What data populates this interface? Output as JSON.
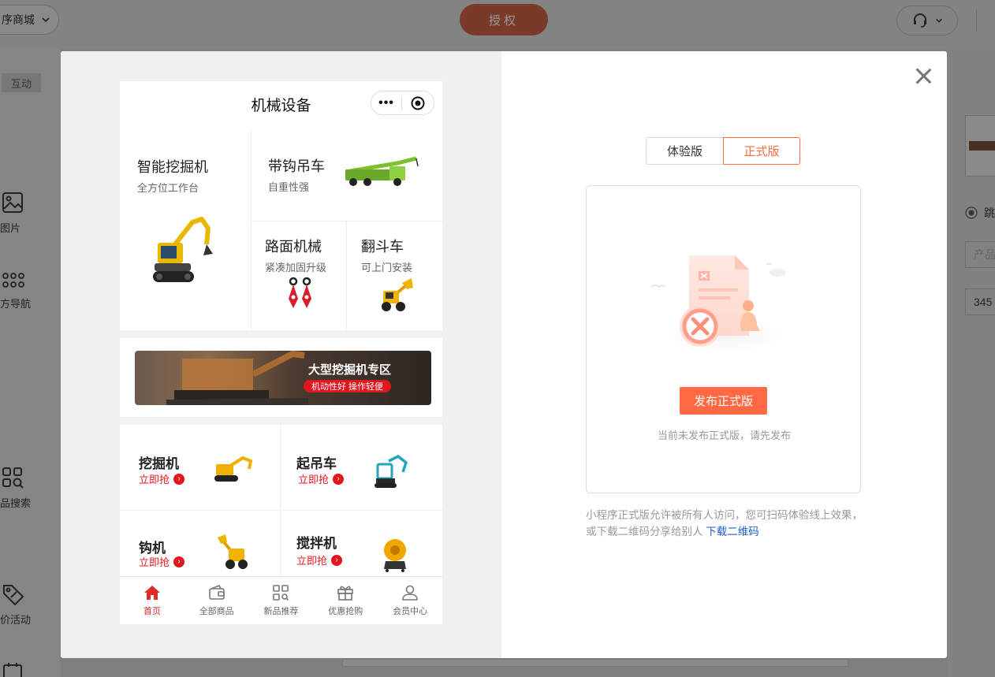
{
  "background": {
    "store_label": "序商城",
    "auth_label": "授权",
    "side_tag": "互动",
    "side_items": [
      {
        "label": "图片",
        "icon": "image-icon"
      },
      {
        "label": "方导航",
        "icon": "grid-dots-icon"
      },
      {
        "label": "品搜索",
        "icon": "search-grid-icon"
      },
      {
        "label": "价活动",
        "icon": "tag-icon"
      }
    ],
    "right_radio": "跳",
    "right_field1": "产品",
    "right_field2": "345"
  },
  "preview": {
    "title": "机械设备",
    "categories": [
      {
        "title": "智能挖掘机",
        "subtitle": "全方位工作台"
      },
      {
        "title": "带钩吊车",
        "subtitle": "自重性强"
      },
      {
        "title": "路面机械",
        "subtitle": "紧凑加固升级"
      },
      {
        "title": "翻斗车",
        "subtitle": "可上门安装"
      }
    ],
    "banner": {
      "title": "大型挖掘机专区",
      "tagline": "机动性好 操作轻便"
    },
    "products": [
      {
        "title": "挖掘机",
        "cta": "立即抢"
      },
      {
        "title": "起吊车",
        "cta": "立即抢"
      },
      {
        "title": "钩机",
        "cta": "立即抢"
      },
      {
        "title": "搅拌机",
        "cta": "立即抢"
      }
    ],
    "tabbar": [
      {
        "label": "首页",
        "icon": "home-icon",
        "active": true
      },
      {
        "label": "全部商品",
        "icon": "wallet-icon"
      },
      {
        "label": "新品推荐",
        "icon": "grid-search-icon"
      },
      {
        "label": "优惠抢购",
        "icon": "gift-icon"
      },
      {
        "label": "会员中心",
        "icon": "user-icon"
      }
    ]
  },
  "panel": {
    "tabs": [
      "体验版",
      "正式版"
    ],
    "active_tab": "正式版",
    "publish_label": "发布正式版",
    "empty_hint": "当前未发布正式版，请先发布",
    "description": "小程序正式版允许被所有人访问，您可扫码体验线上效果，或下载二维码分享给别人",
    "download_link": "下载二维码"
  },
  "colors": {
    "accent": "#ff6a3d",
    "promo_red": "#e0171d",
    "link": "#1e5fc9"
  }
}
